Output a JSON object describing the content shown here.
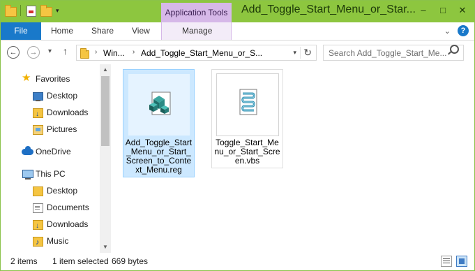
{
  "titlebar": {
    "title": "Add_Toggle_Start_Menu_or_Star...",
    "context_tab": "Application Tools",
    "minimize": "–",
    "maximize": "□",
    "close": "✕"
  },
  "ribbon": {
    "tabs": [
      "File",
      "Home",
      "Share",
      "View",
      "Manage"
    ],
    "expand_glyph": "⌄",
    "help_glyph": "?"
  },
  "navigation": {
    "back_glyph": "←",
    "forward_glyph": "→",
    "recent_glyph": "▾",
    "up_glyph": "↑",
    "address_segments": [
      "Win...",
      "Add_Toggle_Start_Menu_or_S..."
    ],
    "address_separator": "›",
    "dropdown_glyph": "▾",
    "refresh_glyph": "↻",
    "search_placeholder": "Search Add_Toggle_Start_Me..."
  },
  "nav_pane": {
    "items": [
      {
        "label": "Favorites",
        "icon": "star-icon"
      },
      {
        "label": "Desktop",
        "icon": "desktop-icon"
      },
      {
        "label": "Downloads",
        "icon": "downloads-folder-icon"
      },
      {
        "label": "Pictures",
        "icon": "pictures-folder-icon"
      },
      {
        "label": "OneDrive",
        "icon": "onedrive-icon"
      },
      {
        "label": "This PC",
        "icon": "computer-icon"
      },
      {
        "label": "Desktop",
        "icon": "desktop-folder-icon"
      },
      {
        "label": "Documents",
        "icon": "documents-folder-icon"
      },
      {
        "label": "Downloads",
        "icon": "downloads-folder-icon"
      },
      {
        "label": "Music",
        "icon": "music-folder-icon"
      }
    ],
    "scroll_up_glyph": "▲",
    "scroll_down_glyph": "▼"
  },
  "files": [
    {
      "name": "Add_Toggle_Start_Menu_or_Start_Screen_to_Context_Menu.reg",
      "icon": "registry-file-icon",
      "selected": true
    },
    {
      "name": "Toggle_Start_Menu_or_Start_Screen.vbs",
      "icon": "vbscript-file-icon",
      "selected": false
    }
  ],
  "status": {
    "item_count": "2 items",
    "selection": "1 item selected",
    "size": "669 bytes"
  },
  "colors": {
    "titlebar": "#8dc63f",
    "context_tab": "#d6b8e8",
    "file_tab": "#1979ca",
    "selection": "#cce8ff"
  }
}
